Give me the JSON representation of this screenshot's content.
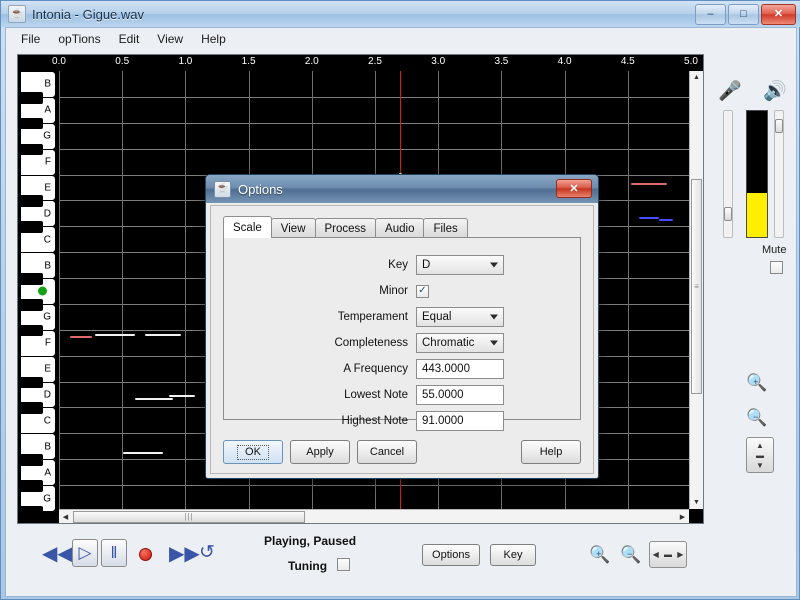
{
  "window": {
    "title": "Intonia - Gigue.wav",
    "icon": "java-coffee-cup-icon",
    "minimize_label": "–",
    "maximize_label": "□",
    "close_label": "✕"
  },
  "menubar": {
    "items": [
      {
        "label": "File"
      },
      {
        "label": "opTions"
      },
      {
        "label": "Edit"
      },
      {
        "label": "View"
      },
      {
        "label": "Help"
      }
    ]
  },
  "editor": {
    "ruler_ticks": [
      "0.0",
      "0.5",
      "1.0",
      "1.5",
      "2.0",
      "2.5",
      "3.0",
      "3.5",
      "4.0",
      "4.5",
      "5.0"
    ],
    "playhead_time": "2.7",
    "keyboard_notes": [
      {
        "label": "B",
        "marked": false
      },
      {
        "label": "A",
        "marked": false
      },
      {
        "label": "G",
        "marked": false
      },
      {
        "label": "F",
        "marked": false
      },
      {
        "label": "E",
        "marked": false
      },
      {
        "label": "D",
        "marked": false
      },
      {
        "label": "C",
        "marked": false
      },
      {
        "label": "B",
        "marked": false
      },
      {
        "label": "A",
        "marked": true
      },
      {
        "label": "G",
        "marked": false
      },
      {
        "label": "F",
        "marked": false
      },
      {
        "label": "E",
        "marked": false
      },
      {
        "label": "D",
        "marked": false
      },
      {
        "label": "C",
        "marked": false
      },
      {
        "label": "B",
        "marked": false
      },
      {
        "label": "A",
        "marked": false
      },
      {
        "label": "G",
        "marked": false
      }
    ],
    "background_color": "#000000",
    "gridline_color": "#7e7e7e",
    "playhead_color": "#e01b1b",
    "hscroll_thumb_grip": "|||",
    "vscroll_thumb_grip": "≡",
    "scroll_left_arrow": "◀",
    "scroll_right_arrow": "▶",
    "scroll_up_arrow": "▲",
    "scroll_down_arrow": "▼"
  },
  "side_panel": {
    "mic_icon": "microphone-icon",
    "speaker_icon": "speaker-icon",
    "mic_level_percent": 18,
    "output_level_percent": 92,
    "meter_fill_percent": 35,
    "meter_fill_color": "#ffee00",
    "mute_label": "Mute",
    "mute_checked": false,
    "zoom_in_icon": "zoom-in-icon",
    "zoom_out_icon": "zoom-out-icon",
    "fit_vertical_icon": "fit-vertical-icon"
  },
  "transport": {
    "rewind_label": "◀◀",
    "play_label": "▷",
    "pause_label": "‖",
    "record_label": "record-dot",
    "forward_label": "▶▶",
    "loop_label": "↺",
    "status": "Playing, Paused",
    "tuning_label": "Tuning",
    "tuning_checked": false,
    "options_button": "Options",
    "key_button": "Key",
    "zoom_in_icon": "zoom-in-icon",
    "zoom_out_icon": "zoom-out-icon",
    "fit_horizontal_icon": "fit-horizontal-icon"
  },
  "dialog": {
    "title": "Options",
    "icon": "java-coffee-cup-icon",
    "close_label": "✕",
    "tabs": [
      {
        "label": "Scale",
        "active": true
      },
      {
        "label": "View",
        "active": false
      },
      {
        "label": "Process",
        "active": false
      },
      {
        "label": "Audio",
        "active": false
      },
      {
        "label": "Files",
        "active": false
      }
    ],
    "fields": [
      {
        "label": "Key",
        "type": "combo",
        "value": "D"
      },
      {
        "label": "Minor",
        "type": "checkbox",
        "value": "✓",
        "checked": true
      },
      {
        "label": "Temperament",
        "type": "combo",
        "value": "Equal"
      },
      {
        "label": "Completeness",
        "type": "combo",
        "value": "Chromatic"
      },
      {
        "label": "A Frequency",
        "type": "text",
        "value": "443.0000"
      },
      {
        "label": "Lowest Note",
        "type": "text",
        "value": "55.0000"
      },
      {
        "label": "Highest Note",
        "type": "text",
        "value": "91.0000"
      }
    ],
    "buttons": {
      "ok": "OK",
      "apply": "Apply",
      "cancel": "Cancel",
      "help": "Help"
    }
  }
}
